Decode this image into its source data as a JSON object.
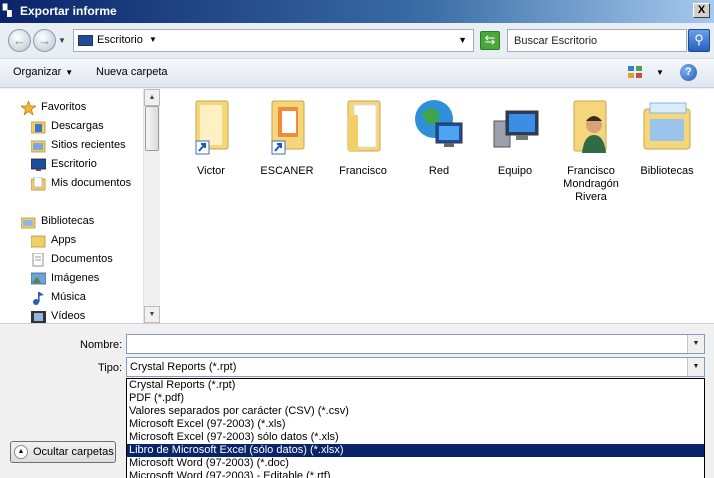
{
  "window": {
    "title": "Exportar informe",
    "close_label": "X"
  },
  "address": {
    "location": "Escritorio",
    "search_placeholder": "Buscar Escritorio"
  },
  "toolbar": {
    "organize_label": "Organizar",
    "new_folder_label": "Nueva carpeta"
  },
  "nav": {
    "items": [
      {
        "label": "Favoritos",
        "icon": "star-icon"
      },
      {
        "label": "Descargas",
        "icon": "download-folder-icon"
      },
      {
        "label": "Sitios recientes",
        "icon": "recent-places-icon"
      },
      {
        "label": "Escritorio",
        "icon": "desktop-icon"
      },
      {
        "label": "Mis documentos",
        "icon": "documents-icon"
      },
      {
        "label": "Bibliotecas",
        "icon": "libraries-icon"
      },
      {
        "label": "Apps",
        "icon": "folder-icon"
      },
      {
        "label": "Documentos",
        "icon": "document-library-icon"
      },
      {
        "label": "Imágenes",
        "icon": "pictures-icon"
      },
      {
        "label": "Música",
        "icon": "music-icon"
      },
      {
        "label": "Vídeos",
        "icon": "videos-icon"
      }
    ]
  },
  "content": {
    "items": [
      {
        "label": "Victor",
        "icon": "folder-shortcut-icon"
      },
      {
        "label": "ESCANER",
        "icon": "folder-shortcut-icon"
      },
      {
        "label": "Francisco",
        "icon": "folder-icon"
      },
      {
        "label": "Red",
        "icon": "network-icon"
      },
      {
        "label": "Equipo",
        "icon": "computer-icon"
      },
      {
        "label": "Francisco Mondragón Rivera",
        "icon": "user-folder-icon"
      },
      {
        "label": "Bibliotecas",
        "icon": "libraries-icon"
      }
    ]
  },
  "form": {
    "name_label": "Nombre:",
    "name_value": "",
    "type_label": "Tipo:",
    "type_value": "Crystal Reports (*.rpt)",
    "type_options": [
      "Crystal Reports (*.rpt)",
      "PDF (*.pdf)",
      "Valores separados por carácter (CSV) (*.csv)",
      "Microsoft Excel (97-2003) (*.xls)",
      "Microsoft Excel (97-2003) sólo datos (*.xls)",
      "Libro de Microsoft Excel (sólo datos) (*.xlsx)",
      "Microsoft Word (97-2003) (*.doc)",
      "Microsoft Word (97-2003) - Editable (*.rtf)"
    ],
    "selected_option_index": 5,
    "hide_folders_label": "Ocultar carpetas"
  },
  "colors": {
    "selection": "#0a246a",
    "folder": "#f5d67a",
    "accent": "#2560c0"
  }
}
